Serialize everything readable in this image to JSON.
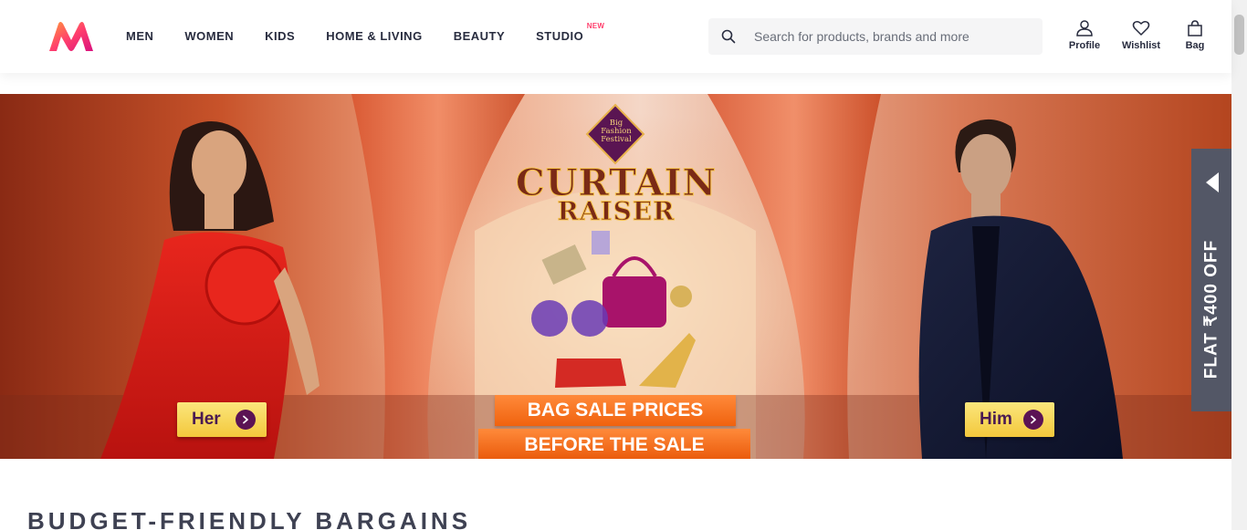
{
  "header": {
    "nav": [
      {
        "label": "MEN"
      },
      {
        "label": "WOMEN"
      },
      {
        "label": "KIDS"
      },
      {
        "label": "HOME & LIVING"
      },
      {
        "label": "BEAUTY"
      },
      {
        "label": "STUDIO",
        "badge": "NEW"
      }
    ],
    "search": {
      "placeholder": "Search for products, brands and more"
    },
    "actions": {
      "profile": "Profile",
      "wishlist": "Wishlist",
      "bag": "Bag"
    }
  },
  "banner": {
    "festival": [
      "Big",
      "Fashion",
      "Festival"
    ],
    "title_line1": "CURTAIN",
    "title_line2": "RAISER",
    "step1": "BAG SALE PRICES",
    "step2": "BEFORE THE SALE",
    "left_button": "Her",
    "right_button": "Him"
  },
  "offer_tab": {
    "text": "FLAT ₹400 OFF"
  },
  "section": {
    "title": "BUDGET-FRIENDLY BARGAINS"
  },
  "colors": {
    "accent": "#ff3f6c",
    "text": "#282c3f",
    "offer_tab": "#535766",
    "step_orange": "#f0620e"
  }
}
